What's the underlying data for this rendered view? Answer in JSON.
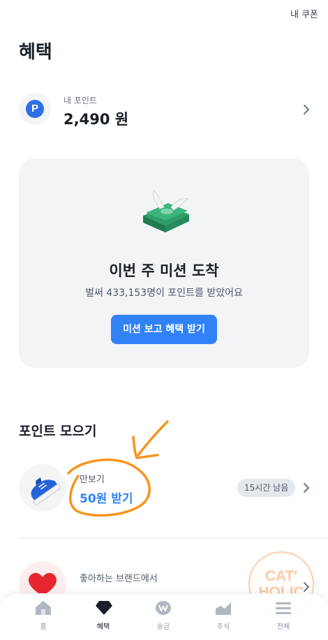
{
  "header": {
    "coupon_label": "내 쿠폰"
  },
  "page": {
    "title": "혜택"
  },
  "points": {
    "icon_letter": "P",
    "label": "내 포인트",
    "value": "2,490 원"
  },
  "mission": {
    "title": "이번 주 미션 도착",
    "subtitle": "벌써 433,153명이 포인트를 받았어요",
    "button_label": "미션 보고 혜택 받기"
  },
  "collect": {
    "section_title": "포인트 모으기",
    "walk": {
      "label": "만보기",
      "reward": "50원 받기",
      "badge": "15시간 남음"
    },
    "brand": {
      "label": "좋아하는 브랜드에서"
    }
  },
  "watermark": {
    "line1": "CAT'",
    "line2": "HOLIC"
  },
  "tabs": [
    {
      "label": "홈",
      "icon": "home-icon"
    },
    {
      "label": "혜택",
      "icon": "benefit-gem-icon",
      "active": true
    },
    {
      "label": "송금",
      "icon": "transfer-won-icon"
    },
    {
      "label": "주식",
      "icon": "stock-chart-icon"
    },
    {
      "label": "전체",
      "icon": "menu-icon"
    }
  ],
  "colors": {
    "accent": "#3182f6",
    "annotation": "#f7941d",
    "card_bg": "#f2f4f6"
  }
}
